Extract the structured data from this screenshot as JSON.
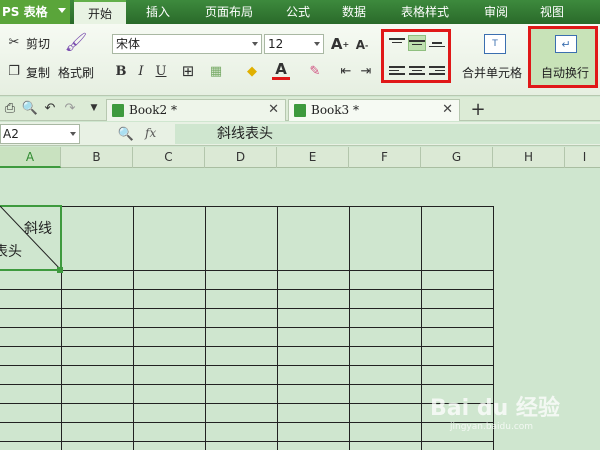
{
  "app": {
    "brand": "PS 表格"
  },
  "menu_tabs": [
    "开始",
    "插入",
    "页面布局",
    "公式",
    "数据",
    "表格样式",
    "审阅",
    "视图"
  ],
  "ribbon": {
    "cut": "剪切",
    "copy": "复制",
    "format_painter": "格式刷",
    "font_name": "宋体",
    "font_size": "12",
    "bold": "B",
    "italic": "I",
    "underline": "U",
    "merge_label": "合并单元格",
    "wrap_label": "自动换行"
  },
  "doc_tabs": [
    {
      "name": "Book2 *"
    },
    {
      "name": "Book3 *"
    }
  ],
  "formula_bar": {
    "name_box": "A2",
    "fx": "fx",
    "content": "斜线表头"
  },
  "columns": [
    "A",
    "B",
    "C",
    "D",
    "E",
    "F",
    "G",
    "H",
    "I"
  ],
  "cell_a2": {
    "top_right": "斜线",
    "bottom_left": "表头"
  },
  "watermark": {
    "brand": "Bai du 经验",
    "url": "jingyan.baidu.com"
  },
  "colors": {
    "accent_green": "#3e9a3e",
    "highlight_red": "#e01818",
    "sheet_bg": "#cfe6cf"
  }
}
